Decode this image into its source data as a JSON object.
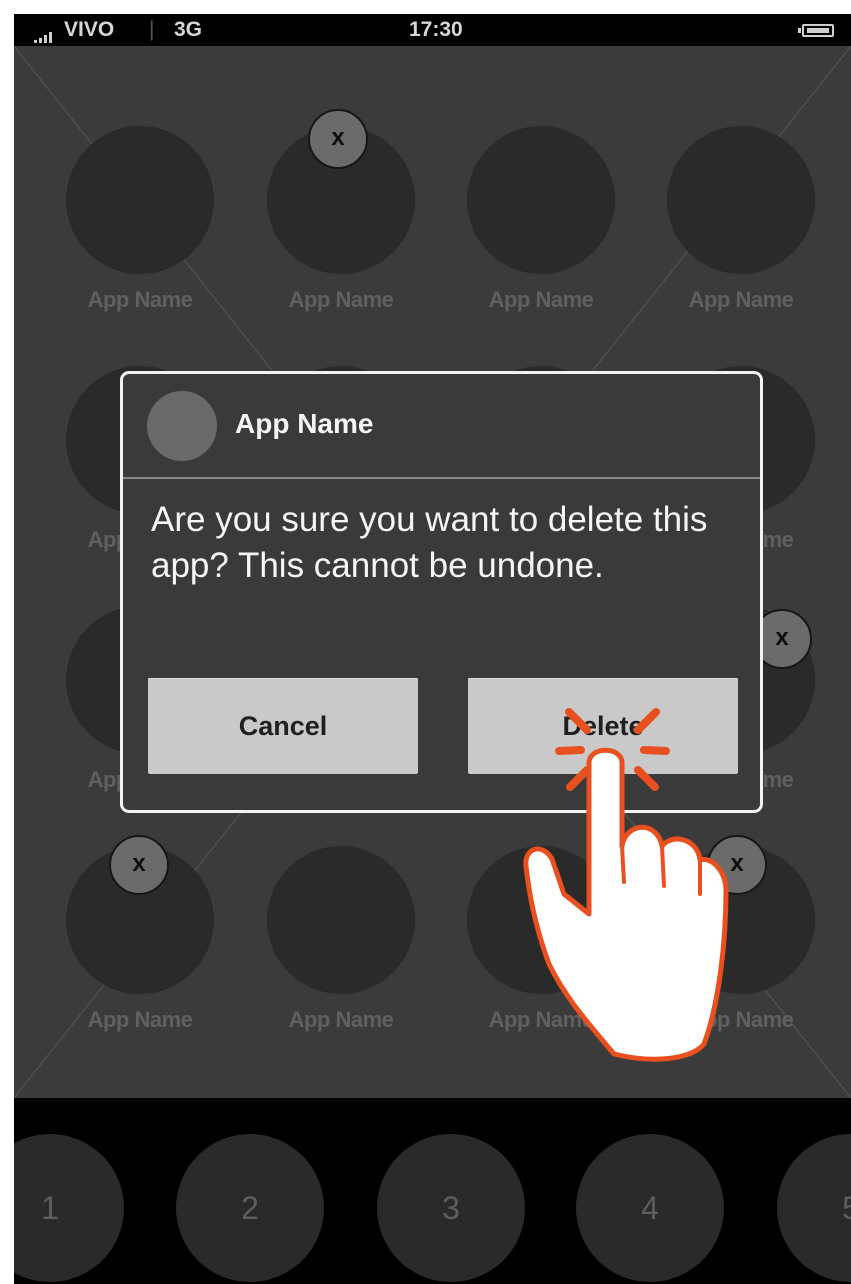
{
  "status_bar": {
    "carrier": "VIVO",
    "separator": "|",
    "network": "3G",
    "time": "17:30",
    "icons": [
      "signal-bars-icon",
      "battery-icon"
    ]
  },
  "apps": {
    "label": "App Name",
    "badge_symbol": "x",
    "delete_badges_on": [
      "row1-col2",
      "row4-col1",
      "row4-col4",
      "row3-col4"
    ]
  },
  "dialog": {
    "title": "App Name",
    "message": "Are you sure you want to delete this app? This cannot be undone.",
    "cancel_label": "Cancel",
    "delete_label": "Delete"
  },
  "dock": {
    "items": [
      "1",
      "2",
      "3",
      "4",
      "5"
    ]
  },
  "gesture": {
    "icon": "tap-hand-icon",
    "target": "delete-button"
  },
  "colors": {
    "tap_accent": "#e8501f",
    "background": "#444444",
    "dialog_border": "#f2f2f2",
    "button": "#c9c9c9"
  }
}
